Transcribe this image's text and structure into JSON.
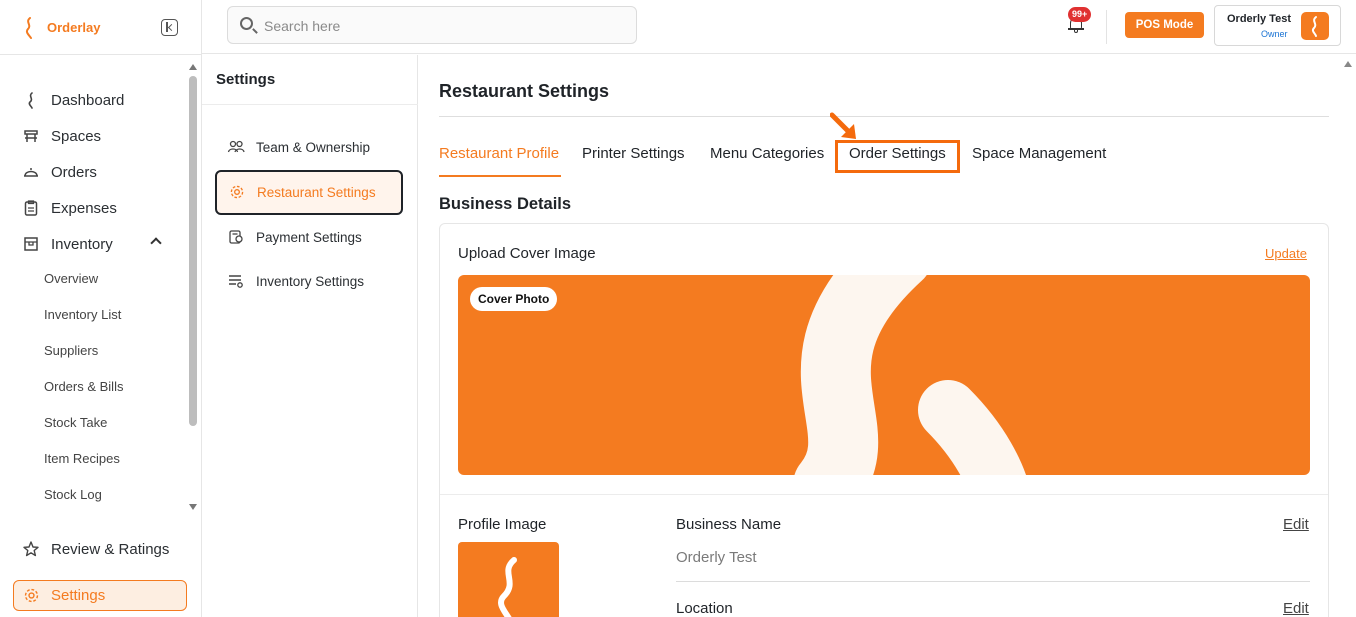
{
  "brand": {
    "name": "Orderlay",
    "accent": "#f47b20"
  },
  "sidebar": {
    "items": [
      {
        "label": "Dashboard",
        "icon": "flame-icon"
      },
      {
        "label": "Spaces",
        "icon": "table-icon"
      },
      {
        "label": "Orders",
        "icon": "cloche-icon"
      },
      {
        "label": "Expenses",
        "icon": "clipboard-icon"
      },
      {
        "label": "Inventory",
        "icon": "box-icon"
      }
    ],
    "inventory_sub": [
      "Overview",
      "Inventory List",
      "Suppliers",
      "Orders & Bills",
      "Stock Take",
      "Item Recipes",
      "Stock Log"
    ],
    "review": "Review & Ratings",
    "settings": "Settings"
  },
  "topbar": {
    "search_placeholder": "Search here",
    "notification_badge": "99+",
    "pos_mode": "POS Mode",
    "user": {
      "name": "Orderly Test",
      "role": "Owner"
    }
  },
  "settings_menu": {
    "heading": "Settings",
    "items": [
      {
        "label": "Team & Ownership",
        "icon": "people-icon"
      },
      {
        "label": "Restaurant Settings",
        "icon": "gear-icon",
        "active": true
      },
      {
        "label": "Payment Settings",
        "icon": "payment-icon"
      },
      {
        "label": "Inventory Settings",
        "icon": "list-settings-icon"
      }
    ]
  },
  "main": {
    "title": "Restaurant Settings",
    "tabs": [
      "Restaurant Profile",
      "Printer Settings",
      "Menu Categories",
      "Order Settings",
      "Space Management"
    ],
    "active_tab": "Restaurant Profile",
    "highlighted_tab": "Order Settings",
    "section_title": "Business Details",
    "upload_cover_label": "Upload Cover Image",
    "update_link": "Update",
    "cover_chip": "Cover Photo",
    "profile_image_label": "Profile Image",
    "fields": [
      {
        "label": "Business Name",
        "value": "Orderly Test",
        "edit": "Edit"
      },
      {
        "label": "Location",
        "edit": "Edit"
      }
    ]
  }
}
